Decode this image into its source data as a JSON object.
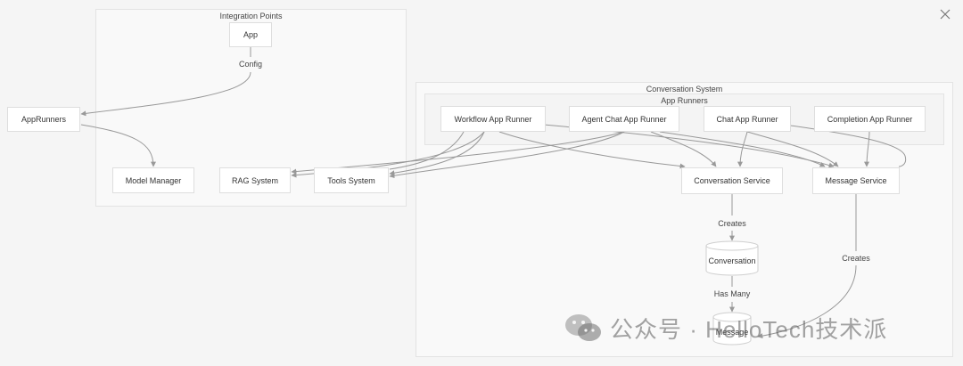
{
  "groups": {
    "integration_points": "Integration Points",
    "conversation_system": "Conversation System",
    "app_runners": "App Runners"
  },
  "nodes": {
    "app": "App",
    "app_runners": "AppRunners",
    "model_manager": "Model Manager",
    "rag_system": "RAG System",
    "tools_system": "Tools System",
    "workflow_app_runner": "Workflow App Runner",
    "agent_chat_app_runner": "Agent Chat App Runner",
    "chat_app_runner": "Chat App Runner",
    "completion_app_runner": "Completion App Runner",
    "conversation_service": "Conversation Service",
    "message_service": "Message Service",
    "conversation": "Conversation",
    "message": "Message"
  },
  "edge_labels": {
    "config": "Config",
    "creates_conversation": "Creates",
    "has_many": "Has Many",
    "creates_message": "Creates"
  },
  "watermark": {
    "text": "公众号 · HelloTech技术派"
  },
  "colors": {
    "edge": "#999999",
    "node_border": "#dedede",
    "group_bg": "#f9f9f9"
  }
}
